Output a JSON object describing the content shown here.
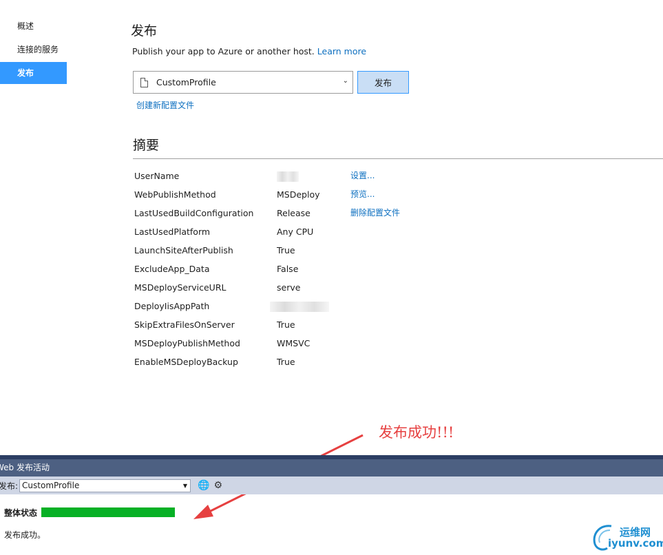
{
  "nav": {
    "items": [
      {
        "label": "概述",
        "active": false
      },
      {
        "label": "连接的服务",
        "active": false
      },
      {
        "label": "发布",
        "active": true
      }
    ]
  },
  "header": {
    "title": "发布",
    "subtitle": "Publish your app to Azure or another host.",
    "learn_more": "Learn more"
  },
  "profile": {
    "selected": "CustomProfile",
    "publish_button": "发布",
    "create_new": "创建新配置文件"
  },
  "summary": {
    "title": "摘要",
    "rows": [
      {
        "key": "UserName",
        "value": ""
      },
      {
        "key": "WebPublishMethod",
        "value": "MSDeploy"
      },
      {
        "key": "LastUsedBuildConfiguration",
        "value": "Release"
      },
      {
        "key": "LastUsedPlatform",
        "value": "Any CPU"
      },
      {
        "key": "LaunchSiteAfterPublish",
        "value": "True"
      },
      {
        "key": "ExcludeApp_Data",
        "value": "False"
      },
      {
        "key": "MSDeployServiceURL",
        "value": "serve"
      },
      {
        "key": "DeployIisAppPath",
        "value": ""
      },
      {
        "key": "SkipExtraFilesOnServer",
        "value": "True"
      },
      {
        "key": "MSDeployPublishMethod",
        "value": "WMSVC"
      },
      {
        "key": "EnableMSDeployBackup",
        "value": "True"
      }
    ],
    "actions": [
      "设置...",
      "预览...",
      "删除配置文件"
    ]
  },
  "annotation": {
    "text": "发布成功!!!",
    "color": "#e64040"
  },
  "panel": {
    "title": "Web 发布活动",
    "toolbar_label": "发布:",
    "selected_profile": "CustomProfile",
    "status_label": "整体状态",
    "progress_percent": 100,
    "status_color": "#06b025",
    "message": "发布成功。"
  },
  "watermark": {
    "cn": "运维网",
    "en": "iyunv.com"
  }
}
